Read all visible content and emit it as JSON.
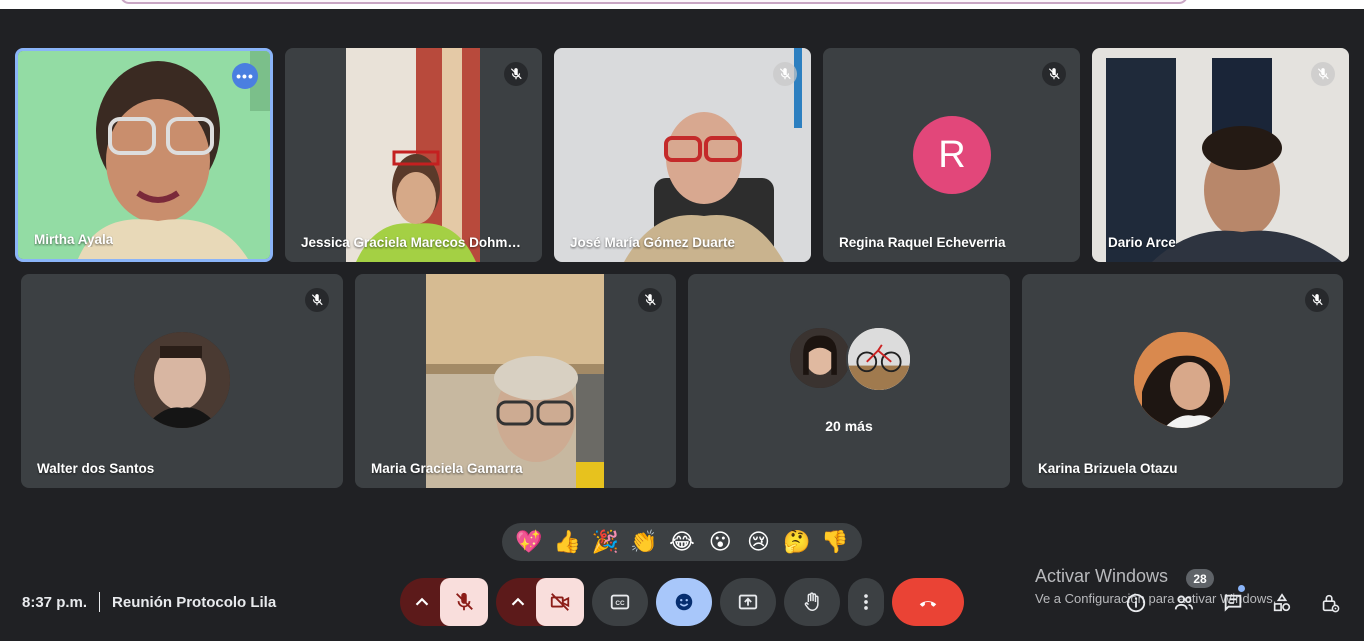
{
  "participants": [
    {
      "name": "Mirtha Ayala",
      "state": "speaking"
    },
    {
      "name": "Jessica Graciela Marecos Dohm…",
      "state": "muted"
    },
    {
      "name": "José María Gómez Duarte",
      "state": "muted"
    },
    {
      "name": "Regina Raquel Echeverria",
      "state": "muted",
      "initial": "R",
      "avatar_color": "#e2477a"
    },
    {
      "name": "Dario Arce",
      "state": "muted"
    },
    {
      "name": "Walter dos Santos",
      "state": "muted"
    },
    {
      "name": "Maria Graciela Gamarra",
      "state": "muted"
    },
    {
      "name": "Karina Brizuela Otazu",
      "state": "muted"
    }
  ],
  "others_tile": {
    "label": "20 más"
  },
  "reactions": [
    "💖",
    "👍",
    "🎉",
    "👏",
    "😂",
    "😮",
    "😢",
    "🤔",
    "👎"
  ],
  "meeting": {
    "time": "8:37 p.m.",
    "title": "Reunión Protocolo Lila"
  },
  "watermark": {
    "line1": "Activar Windows",
    "line2": "Ve a Configuración para activar Windows."
  },
  "participant_count": "28",
  "colors": {
    "background": "#202124",
    "tile": "#3c4043",
    "active_border": "#8ab4f8",
    "danger_dark": "#5c1a1a",
    "danger_light": "#f9dedc",
    "end_call": "#ea4335",
    "reaction_active": "#a8c7fa"
  },
  "icons": {
    "mic": "mic-off-icon",
    "camera": "videocam-off-icon",
    "captions": "closed-caption-icon",
    "reactions": "emoji-icon",
    "present": "present-to-all-icon",
    "hand": "raise-hand-icon",
    "more": "more-vert-icon",
    "end": "call-end-icon",
    "info": "info-icon",
    "people": "people-icon",
    "chat": "chat-icon",
    "activities": "activities-icon",
    "host": "host-controls-icon"
  }
}
